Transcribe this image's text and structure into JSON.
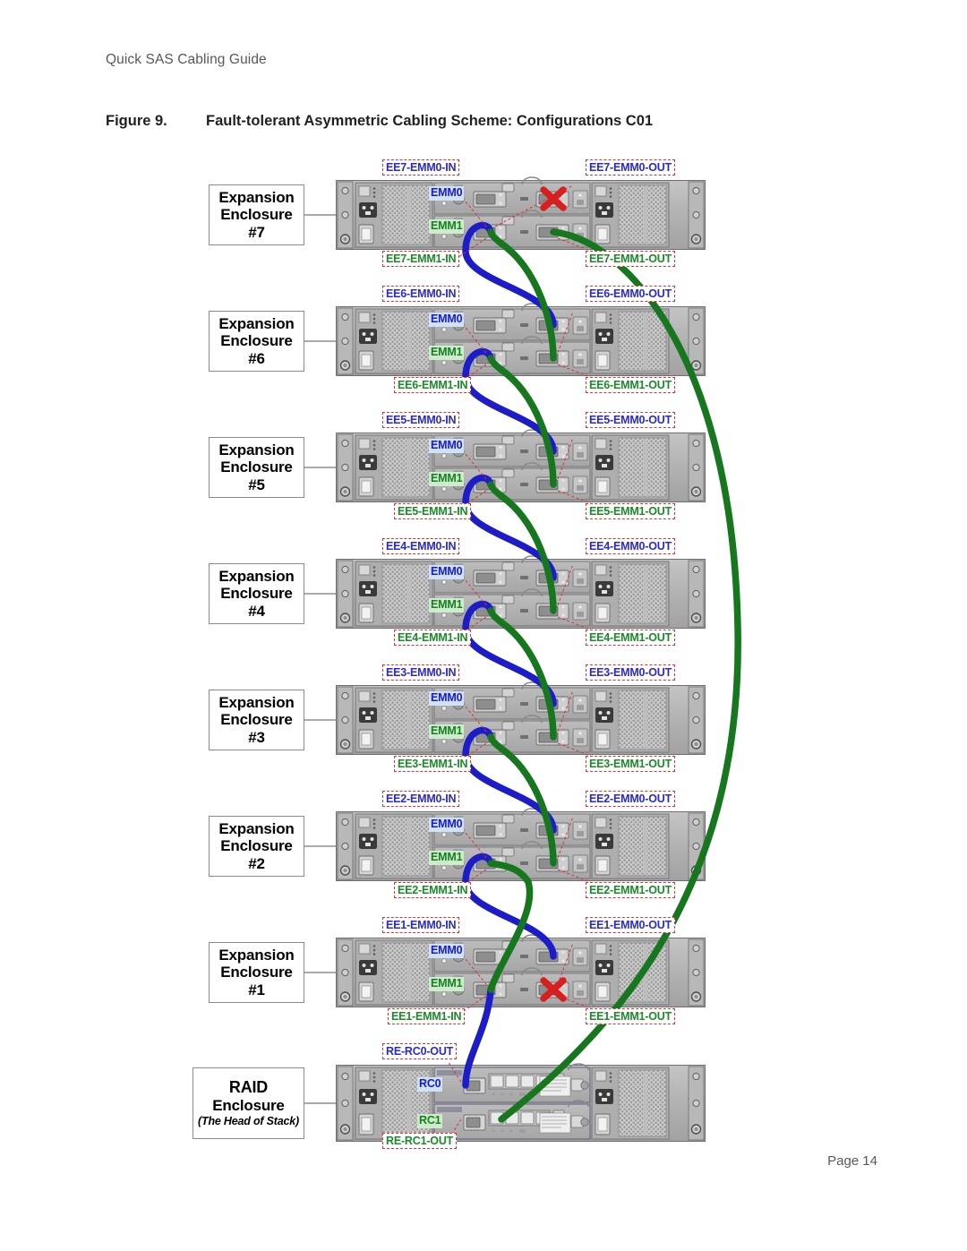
{
  "document": {
    "header": "Quick SAS Cabling Guide",
    "figure_number": "Figure 9.",
    "figure_title": "Fault-tolerant Asymmetric Cabling Scheme: Configurations C01",
    "footer": "Page 14"
  },
  "colors": {
    "cable_emm0": "#1c1cc8",
    "cable_emm1": "#17771f",
    "tag_border": "#e03030",
    "tag_text_blue": "#2a2ad0",
    "tag_text_green": "#1b8a28",
    "badge_blue_bg": "#cfe2f7",
    "badge_green_bg": "#cdeccd",
    "chassis_body": "#b6b6b6",
    "x_mark": "#d81f1f"
  },
  "enclosures": [
    {
      "id": "ee7",
      "label": {
        "line1": "Expansion",
        "line2": "Enclosure",
        "line3": "#7"
      },
      "modules": [
        {
          "name": "EMM0",
          "kind": "blue"
        },
        {
          "name": "EMM1",
          "kind": "green"
        }
      ],
      "ports": [
        {
          "name": "EE7-EMM0-IN",
          "kind": "blue",
          "side": "left",
          "row": "top",
          "state": "connected"
        },
        {
          "name": "EE7-EMM0-OUT",
          "kind": "blue",
          "side": "right",
          "row": "top",
          "state": "blocked"
        },
        {
          "name": "EE7-EMM1-IN",
          "kind": "green",
          "side": "left",
          "row": "bottom",
          "state": "connected"
        },
        {
          "name": "EE7-EMM1-OUT",
          "kind": "green",
          "side": "right",
          "row": "bottom",
          "state": "connected"
        }
      ]
    },
    {
      "id": "ee6",
      "label": {
        "line1": "Expansion",
        "line2": "Enclosure",
        "line3": "#6"
      },
      "modules": [
        {
          "name": "EMM0",
          "kind": "blue"
        },
        {
          "name": "EMM1",
          "kind": "green"
        }
      ],
      "ports": [
        {
          "name": "EE6-EMM0-IN",
          "kind": "blue",
          "side": "left",
          "row": "top",
          "state": "connected"
        },
        {
          "name": "EE6-EMM0-OUT",
          "kind": "blue",
          "side": "right",
          "row": "top",
          "state": "connected"
        },
        {
          "name": "EE6-EMM1-IN",
          "kind": "green",
          "side": "left",
          "row": "bottom",
          "state": "connected"
        },
        {
          "name": "EE6-EMM1-OUT",
          "kind": "green",
          "side": "right",
          "row": "bottom",
          "state": "connected"
        }
      ]
    },
    {
      "id": "ee5",
      "label": {
        "line1": "Expansion",
        "line2": "Enclosure",
        "line3": "#5"
      },
      "modules": [
        {
          "name": "EMM0",
          "kind": "blue"
        },
        {
          "name": "EMM1",
          "kind": "green"
        }
      ],
      "ports": [
        {
          "name": "EE5-EMM0-IN",
          "kind": "blue",
          "side": "left",
          "row": "top",
          "state": "connected"
        },
        {
          "name": "EE5-EMM0-OUT",
          "kind": "blue",
          "side": "right",
          "row": "top",
          "state": "connected"
        },
        {
          "name": "EE5-EMM1-IN",
          "kind": "green",
          "side": "left",
          "row": "bottom",
          "state": "connected"
        },
        {
          "name": "EE5-EMM1-OUT",
          "kind": "green",
          "side": "right",
          "row": "bottom",
          "state": "connected"
        }
      ]
    },
    {
      "id": "ee4",
      "label": {
        "line1": "Expansion",
        "line2": "Enclosure",
        "line3": "#4"
      },
      "modules": [
        {
          "name": "EMM0",
          "kind": "blue"
        },
        {
          "name": "EMM1",
          "kind": "green"
        }
      ],
      "ports": [
        {
          "name": "EE4-EMM0-IN",
          "kind": "blue",
          "side": "left",
          "row": "top",
          "state": "connected"
        },
        {
          "name": "EE4-EMM0-OUT",
          "kind": "blue",
          "side": "right",
          "row": "top",
          "state": "connected"
        },
        {
          "name": "EE4-EMM1-IN",
          "kind": "green",
          "side": "left",
          "row": "bottom",
          "state": "connected"
        },
        {
          "name": "EE4-EMM1-OUT",
          "kind": "green",
          "side": "right",
          "row": "bottom",
          "state": "connected"
        }
      ]
    },
    {
      "id": "ee3",
      "label": {
        "line1": "Expansion",
        "line2": "Enclosure",
        "line3": "#3"
      },
      "modules": [
        {
          "name": "EMM0",
          "kind": "blue"
        },
        {
          "name": "EMM1",
          "kind": "green"
        }
      ],
      "ports": [
        {
          "name": "EE3-EMM0-IN",
          "kind": "blue",
          "side": "left",
          "row": "top",
          "state": "connected"
        },
        {
          "name": "EE3-EMM0-OUT",
          "kind": "blue",
          "side": "right",
          "row": "top",
          "state": "connected"
        },
        {
          "name": "EE3-EMM1-IN",
          "kind": "green",
          "side": "left",
          "row": "bottom",
          "state": "connected"
        },
        {
          "name": "EE3-EMM1-OUT",
          "kind": "green",
          "side": "right",
          "row": "bottom",
          "state": "connected"
        }
      ]
    },
    {
      "id": "ee2",
      "label": {
        "line1": "Expansion",
        "line2": "Enclosure",
        "line3": "#2"
      },
      "modules": [
        {
          "name": "EMM0",
          "kind": "blue"
        },
        {
          "name": "EMM1",
          "kind": "green"
        }
      ],
      "ports": [
        {
          "name": "EE2-EMM0-IN",
          "kind": "blue",
          "side": "left",
          "row": "top",
          "state": "connected"
        },
        {
          "name": "EE2-EMM0-OUT",
          "kind": "blue",
          "side": "right",
          "row": "top",
          "state": "connected"
        },
        {
          "name": "EE2-EMM1-IN",
          "kind": "green",
          "side": "left",
          "row": "bottom",
          "state": "connected"
        },
        {
          "name": "EE2-EMM1-OUT",
          "kind": "green",
          "side": "right",
          "row": "bottom",
          "state": "connected"
        }
      ]
    },
    {
      "id": "ee1",
      "label": {
        "line1": "Expansion",
        "line2": "Enclosure",
        "line3": "#1"
      },
      "modules": [
        {
          "name": "EMM0",
          "kind": "blue"
        },
        {
          "name": "EMM1",
          "kind": "green"
        }
      ],
      "ports": [
        {
          "name": "EE1-EMM0-IN",
          "kind": "blue",
          "side": "left",
          "row": "top",
          "state": "connected"
        },
        {
          "name": "EE1-EMM0-OUT",
          "kind": "blue",
          "side": "right",
          "row": "top",
          "state": "connected"
        },
        {
          "name": "EE1-EMM1-IN",
          "kind": "green",
          "side": "left",
          "row": "bottom",
          "state": "connected"
        },
        {
          "name": "EE1-EMM1-OUT",
          "kind": "green",
          "side": "right",
          "row": "bottom",
          "state": "blocked"
        }
      ]
    },
    {
      "id": "raid",
      "label": {
        "line1": "RAID",
        "line2": "Enclosure",
        "line3": "(The Head of Stack)"
      },
      "modules": [
        {
          "name": "RC0",
          "kind": "blue"
        },
        {
          "name": "RC1",
          "kind": "green"
        }
      ],
      "ports": [
        {
          "name": "RE-RC0-OUT",
          "kind": "blue",
          "side": "left",
          "row": "top",
          "state": "connected"
        },
        {
          "name": "RE-RC1-OUT",
          "kind": "green",
          "side": "left",
          "row": "bottom",
          "state": "connected"
        }
      ]
    }
  ],
  "cabling": {
    "emm0_chain": [
      {
        "from": "RE-RC0-OUT",
        "to": "EE1-EMM0-IN"
      },
      {
        "from": "EE1-EMM0-OUT",
        "to": "EE2-EMM0-IN"
      },
      {
        "from": "EE2-EMM0-OUT",
        "to": "EE3-EMM0-IN"
      },
      {
        "from": "EE3-EMM0-OUT",
        "to": "EE4-EMM0-IN"
      },
      {
        "from": "EE4-EMM0-OUT",
        "to": "EE5-EMM0-IN"
      },
      {
        "from": "EE5-EMM0-OUT",
        "to": "EE6-EMM0-IN"
      },
      {
        "from": "EE6-EMM0-OUT",
        "to": "EE7-EMM0-IN"
      }
    ],
    "emm1_chain": [
      {
        "from": "EE7-EMM1-OUT",
        "to": "RE-RC1-OUT"
      },
      {
        "from": "EE7-EMM1-IN",
        "to": "EE6-EMM1-OUT"
      },
      {
        "from": "EE6-EMM1-IN",
        "to": "EE5-EMM1-OUT"
      },
      {
        "from": "EE5-EMM1-IN",
        "to": "EE4-EMM1-OUT"
      },
      {
        "from": "EE4-EMM1-IN",
        "to": "EE3-EMM1-OUT"
      },
      {
        "from": "EE3-EMM1-IN",
        "to": "EE2-EMM1-OUT"
      },
      {
        "from": "EE2-EMM1-IN",
        "to": "EE1-EMM1-IN"
      }
    ],
    "unused_ports": [
      "EE7-EMM0-OUT",
      "EE1-EMM1-OUT"
    ]
  }
}
